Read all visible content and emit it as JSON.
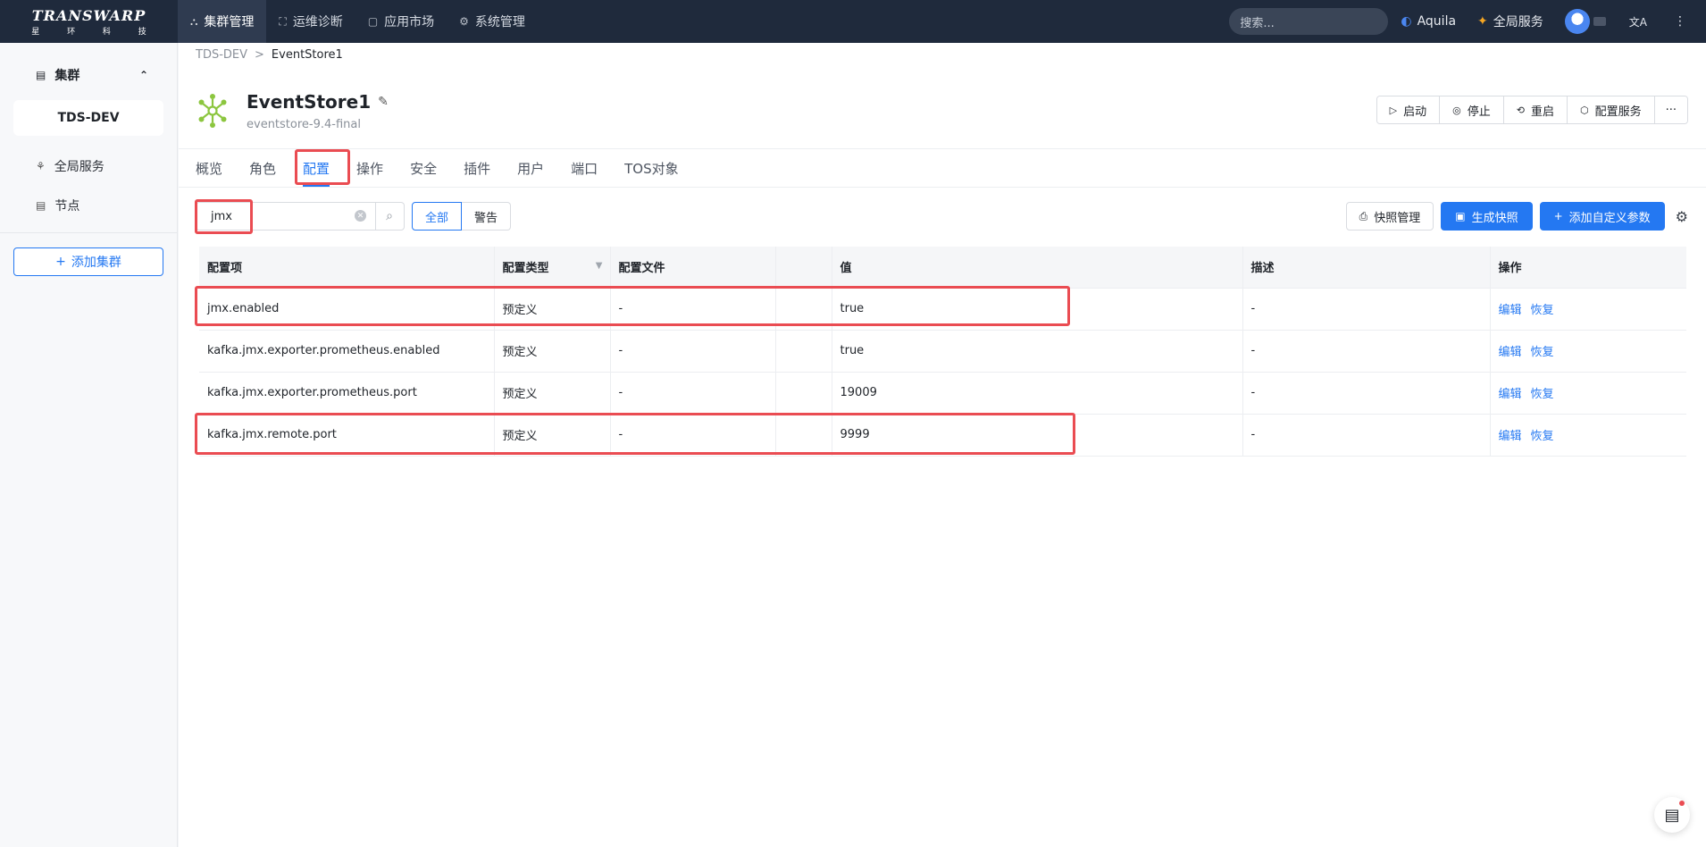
{
  "brand": {
    "name": "TRANSWARP",
    "sub": "星 环 科 技"
  },
  "topnav": [
    {
      "label": "集群管理",
      "icon": "cluster-icon",
      "active": true
    },
    {
      "label": "运维诊断",
      "icon": "diagnose-icon"
    },
    {
      "label": "应用市场",
      "icon": "market-icon"
    },
    {
      "label": "系统管理",
      "icon": "gear-icon"
    }
  ],
  "topright": {
    "search_placeholder": "搜索...",
    "aquila": "Aquila",
    "global": "全局服务",
    "lang": "文A",
    "more": "⋮"
  },
  "sidebar": {
    "group": "集群",
    "cluster": "TDS-DEV",
    "items": [
      {
        "label": "全局服务"
      },
      {
        "label": "节点"
      }
    ],
    "add": "添加集群"
  },
  "breadcrumb": {
    "parent": "TDS-DEV",
    "sep": ">",
    "current": "EventStore1"
  },
  "service": {
    "name": "EventStore1",
    "version": "eventstore-9.4-final"
  },
  "actions": {
    "start": "启动",
    "stop": "停止",
    "restart": "重启",
    "config": "配置服务",
    "more": "···"
  },
  "tabs": [
    "概览",
    "角色",
    "配置",
    "操作",
    "安全",
    "插件",
    "用户",
    "端口",
    "TOS对象"
  ],
  "filter": {
    "value": "jmx",
    "all": "全部",
    "warn": "警告"
  },
  "toolbar": {
    "snapshot_mgmt": "快照管理",
    "gen_snapshot": "生成快照",
    "add_param": "添加自定义参数"
  },
  "table": {
    "headers": [
      "配置项",
      "配置类型",
      "配置文件",
      "",
      "值",
      "描述",
      "操作"
    ],
    "rows": [
      {
        "key": "jmx.enabled",
        "type": "预定义",
        "file": "-",
        "extra": "",
        "value": "true",
        "desc": "-"
      },
      {
        "key": "kafka.jmx.exporter.prometheus.enabled",
        "type": "预定义",
        "file": "-",
        "extra": "",
        "value": "true",
        "desc": "-"
      },
      {
        "key": "kafka.jmx.exporter.prometheus.port",
        "type": "预定义",
        "file": "-",
        "extra": "",
        "value": "19009",
        "desc": "-"
      },
      {
        "key": "kafka.jmx.remote.port",
        "type": "预定义",
        "file": "-",
        "extra": "",
        "value": "9999",
        "desc": "-"
      }
    ],
    "op_edit": "编辑",
    "op_restore": "恢复"
  },
  "colors": {
    "accent": "#2478f2",
    "highlight": "#ea4c52",
    "topbar": "#1f2a3c"
  }
}
